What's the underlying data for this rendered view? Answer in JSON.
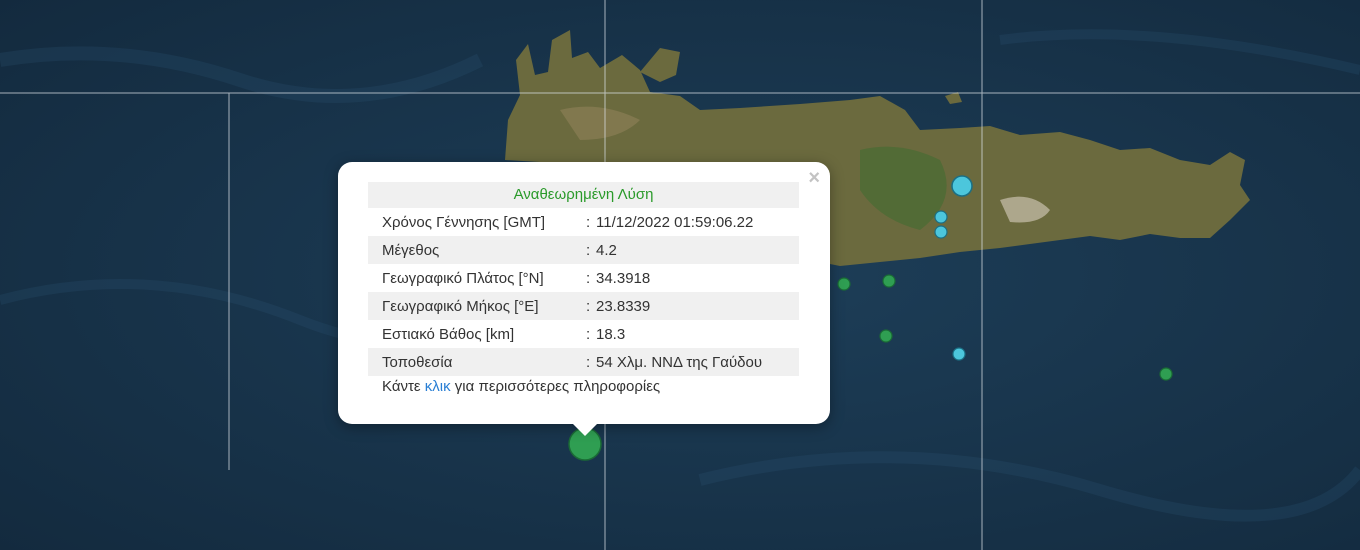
{
  "popup": {
    "title": "Αναθεωρημένη Λύση",
    "close_label": "×",
    "rows": [
      {
        "label": "Χρόνος Γέννησης [GMT]",
        "value": "11/12/2022 01:59:06.22"
      },
      {
        "label": "Μέγεθος",
        "value": "4.2"
      },
      {
        "label": "Γεωγραφικό Πλάτος [°N]",
        "value": "34.3918"
      },
      {
        "label": "Γεωγραφικό Μήκος [°E]",
        "value": "23.8339"
      },
      {
        "label": "Εστιακό Βάθος [km]",
        "value": "18.3"
      },
      {
        "label": "Τοποθεσία",
        "value": "54 Χλμ. ΝΝΔ της Γαύδου"
      }
    ],
    "separator": ":",
    "more_prefix": "Κάντε",
    "more_link": "κλικ",
    "more_suffix": "για περισσότερες πληροφορίες"
  },
  "map": {
    "colors": {
      "sea": "#17324a",
      "land": "#6b6a3e",
      "marker_green": "#2f9e52",
      "marker_cyan": "#4cc6dc"
    },
    "selected_event": {
      "magnitude": 4.2,
      "color": "green"
    }
  }
}
